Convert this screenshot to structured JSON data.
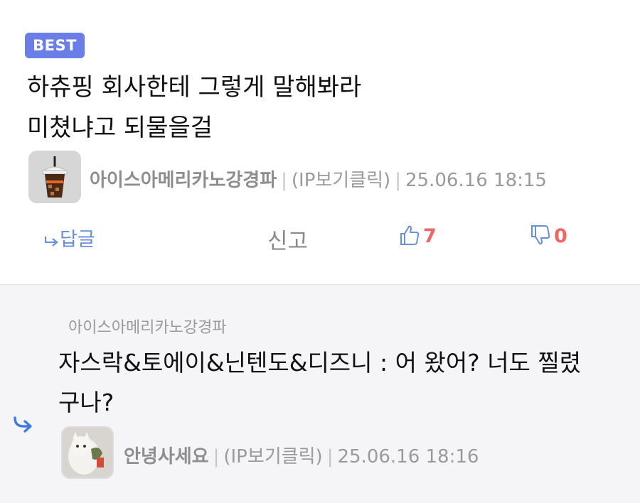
{
  "post": {
    "badge": "BEST",
    "lines": [
      "하츄핑 회사한테 그렇게 말해봐라",
      "미쳤냐고 되물을걸"
    ],
    "author": "아이스아메리카노강경파",
    "ip": "(IP보기클릭)",
    "datetime": "25.06.16 18:15",
    "reply_label": "답글",
    "report_label": "신고",
    "likes": "7",
    "dislikes": "0"
  },
  "reply": {
    "parent_author": "아이스아메리카노강경파",
    "lines": [
      "자스락&토에이&닌텐도&디즈니 : 어 왔어? 너도 찔렸",
      "구나?"
    ],
    "author": "안녕사세요",
    "ip": "(IP보기클릭)",
    "datetime": "25.06.16 18:16"
  },
  "icons": {
    "reply": "reply-arrow-icon",
    "like": "thumbs-up-icon",
    "dislike": "thumbs-down-icon",
    "nested": "nested-reply-icon"
  },
  "colors": {
    "badge": "#6b7ee8",
    "accent": "#6b8fd6",
    "count": "#e66666"
  }
}
